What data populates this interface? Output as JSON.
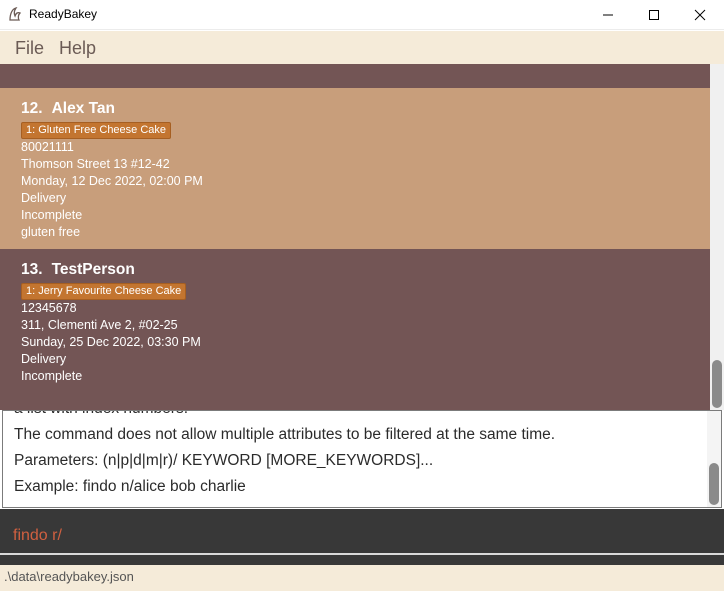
{
  "window": {
    "title": "ReadyBakey",
    "icon": "readybakey-logo-icon"
  },
  "menu": {
    "items": [
      {
        "label": "File"
      },
      {
        "label": "Help"
      }
    ]
  },
  "orders": [
    {
      "index": "12.",
      "name": "Alex Tan",
      "tag": "1: Gluten Free Cheese Cake",
      "phone": "80021111",
      "address": "Thomson Street 13 #12-42",
      "datetime": "Monday, 12 Dec 2022, 02:00 PM",
      "delivery": "Delivery",
      "status": "Incomplete",
      "remark": "gluten free"
    },
    {
      "index": "13.",
      "name": "TestPerson",
      "tag": "1: Jerry Favourite Cheese Cake",
      "phone": "12345678",
      "address": "311, Clementi Ave 2, #02-25",
      "datetime": "Sunday, 25 Dec 2022, 03:30 PM",
      "delivery": "Delivery",
      "status": "Incomplete"
    }
  ],
  "result": {
    "lines": [
      "a list with index numbers.",
      "The command does not allow multiple attributes to be filtered at the same time.",
      "Parameters: (n|p|d|m|r)/ KEYWORD [MORE_KEYWORDS]...",
      "Example: findo n/alice bob charlie"
    ]
  },
  "command": {
    "value": "findo r/"
  },
  "status": {
    "file_path": ".\\data\\readybakey.json"
  },
  "colors": {
    "list_background": "#735555",
    "selected_card": "#c89e7b",
    "tag_background": "#c37530",
    "menu_background": "#f5ebd9",
    "command_background": "#383838",
    "command_text": "#d06040"
  }
}
